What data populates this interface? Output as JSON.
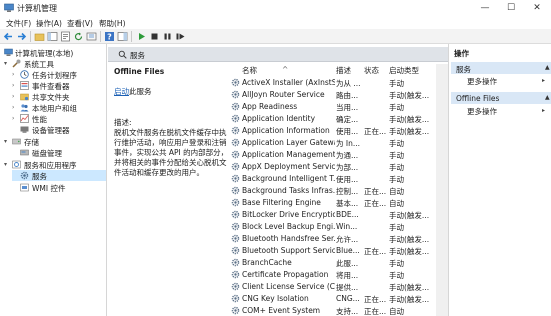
{
  "window": {
    "title": "计算机管理",
    "minimize": "—",
    "maximize": "☐",
    "close": "✕"
  },
  "menu": [
    "文件(F)",
    "操作(A)",
    "查看(V)",
    "帮助(H)"
  ],
  "tree": {
    "root": "计算机管理(本地)",
    "system_tools": "系统工具",
    "task_scheduler": "任务计划程序",
    "event_viewer": "事件查看器",
    "shared_folders": "共享文件夹",
    "local_users": "本地用户和组",
    "performance": "性能",
    "device_manager": "设备管理器",
    "storage": "存储",
    "disk_management": "磁盘管理",
    "services_apps": "服务和应用程序",
    "services": "服务",
    "wmi": "WMI 控件"
  },
  "center": {
    "header": "服务",
    "selected_service": "Offline Files",
    "action_link": "启动",
    "action_suffix": "此服务",
    "desc_label": "描述:",
    "description": "脱机文件服务在脱机文件缓存中执行维护活动，响应用户登录和注销事件，实现公共 API 的内部部分，并将相关的事件分配给关心脱机文件活动和缓存更改的用户。",
    "columns": {
      "name": "名称",
      "desc": "描述",
      "status": "状态",
      "startup": "启动类型"
    },
    "rows": [
      {
        "name": "ActiveX Installer (AxInstSV)",
        "desc": "为从 ...",
        "status": "",
        "startup": "手动"
      },
      {
        "name": "AllJoyn Router Service",
        "desc": "路由...",
        "status": "",
        "startup": "手动(触发..."
      },
      {
        "name": "App Readiness",
        "desc": "当用...",
        "status": "",
        "startup": "手动"
      },
      {
        "name": "Application Identity",
        "desc": "确定...",
        "status": "",
        "startup": "手动(触发..."
      },
      {
        "name": "Application Information",
        "desc": "使用...",
        "status": "正在...",
        "startup": "手动(触发..."
      },
      {
        "name": "Application Layer Gatewa...",
        "desc": "为 In...",
        "status": "",
        "startup": "手动"
      },
      {
        "name": "Application Management",
        "desc": "为通...",
        "status": "",
        "startup": "手动"
      },
      {
        "name": "AppX Deployment Servic...",
        "desc": "为部...",
        "status": "",
        "startup": "手动"
      },
      {
        "name": "Background Intelligent T...",
        "desc": "使用...",
        "status": "",
        "startup": "手动"
      },
      {
        "name": "Background Tasks Infras...",
        "desc": "控制...",
        "status": "正在...",
        "startup": "自动"
      },
      {
        "name": "Base Filtering Engine",
        "desc": "基本...",
        "status": "正在...",
        "startup": "自动"
      },
      {
        "name": "BitLocker Drive Encryptio...",
        "desc": "BDE...",
        "status": "",
        "startup": "手动(触发..."
      },
      {
        "name": "Block Level Backup Engi...",
        "desc": "Win...",
        "status": "",
        "startup": "手动"
      },
      {
        "name": "Bluetooth Handsfree Ser...",
        "desc": "允许...",
        "status": "",
        "startup": "手动(触发..."
      },
      {
        "name": "Bluetooth Support Service",
        "desc": "Blue...",
        "status": "正在...",
        "startup": "手动(触发..."
      },
      {
        "name": "BranchCache",
        "desc": "此服...",
        "status": "",
        "startup": "手动"
      },
      {
        "name": "Certificate Propagation",
        "desc": "将用...",
        "status": "",
        "startup": "手动"
      },
      {
        "name": "Client License Service (Cli...",
        "desc": "提供...",
        "status": "",
        "startup": "手动(触发..."
      },
      {
        "name": "CNG Key Isolation",
        "desc": "CNG...",
        "status": "正在...",
        "startup": "手动(触发..."
      },
      {
        "name": "COM+ Event System",
        "desc": "支持...",
        "status": "正在...",
        "startup": "自动"
      }
    ]
  },
  "right": {
    "title": "操作",
    "section1": "服务",
    "section1_action": "更多操作",
    "section2": "Offline Files",
    "section2_action": "更多操作"
  },
  "colors": {
    "selection": "#cce8ff",
    "section_bg": "#d9e7f6",
    "header_bg": "#dfe3e8",
    "link": "#1a5fb4"
  }
}
